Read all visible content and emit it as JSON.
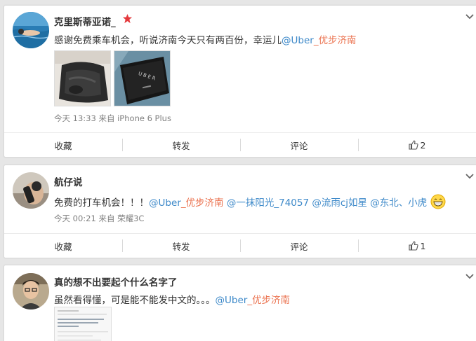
{
  "posts": [
    {
      "user": "克里斯蒂亚诺_",
      "text_prefix": "感谢免费乘车机会，听说济南今天只有两百份，幸运儿",
      "mention_at": "@",
      "mention_uber": "Uber",
      "mention_rest": "_优步济南",
      "time": "今天 13:33",
      "from": "来自",
      "device": "iPhone 6 Plus",
      "actions": {
        "fav": "收藏",
        "repost": "转发",
        "comment": "评论",
        "likes": "2"
      }
    },
    {
      "user": "航仔说",
      "text_prefix": "免费的打车机会！！！",
      "mention1_at": "@",
      "mention1_uber": "Uber",
      "mention1_rest": "_优步济南",
      "mentions_rest": " @一抹阳光_74057 @流雨cj如星 @东北、小虎",
      "time": "今天 00:21",
      "from": "来自",
      "device": "荣耀3C",
      "actions": {
        "fav": "收藏",
        "repost": "转发",
        "comment": "评论",
        "likes": "1"
      }
    },
    {
      "user": "真的想不出要起个什么名字了",
      "text_prefix": "虽然看得懂，可是能不能发中文的。。。",
      "mention_at": "@",
      "mention_uber": "Uber",
      "mention_rest": "_优步济南"
    }
  ],
  "icons": {
    "chevron": "chevron-down-icon",
    "star": "star-icon",
    "like": "thumbs-up-icon",
    "emoji": "grin-emoji-icon"
  },
  "colors": {
    "link_blue": "#3d89c9",
    "mention_orange": "#eb7350",
    "meta_gray": "#808080",
    "star_red": "#e4393c"
  }
}
